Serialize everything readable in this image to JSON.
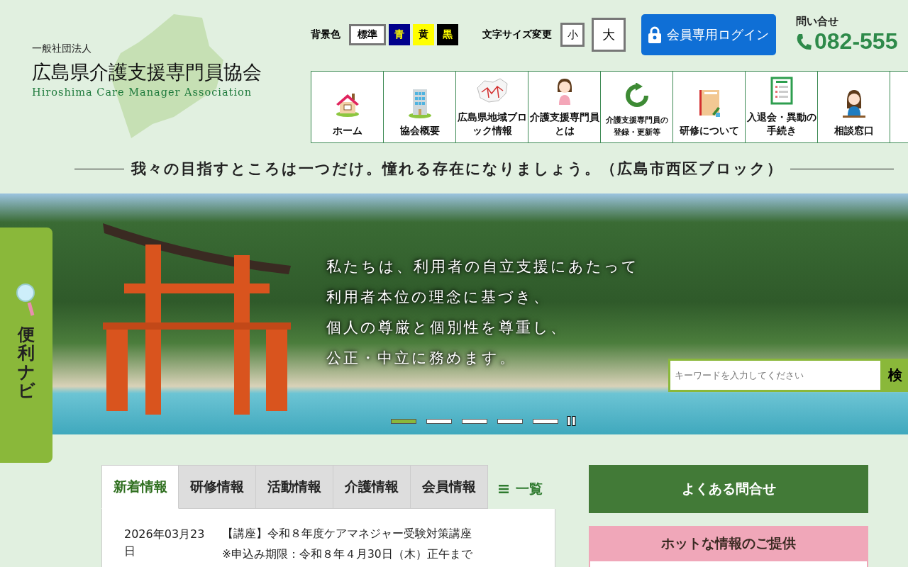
{
  "header": {
    "org_type": "一般社団法人",
    "org_name": "広島県介護支援専門員協会",
    "org_name_en": "Hiroshima Care Manager Association",
    "bg_color": {
      "label": "背景色",
      "options": [
        {
          "label": "標準",
          "kind": "standard",
          "selected": true
        },
        {
          "label": "青",
          "kind": "blue",
          "selected": false
        },
        {
          "label": "黄",
          "kind": "yellow",
          "selected": false
        },
        {
          "label": "黒",
          "kind": "black",
          "selected": false
        }
      ]
    },
    "font_size": {
      "label": "文字サイズ変更",
      "options": [
        {
          "label": "小",
          "kind": "small"
        },
        {
          "label": "大",
          "kind": "large"
        }
      ]
    },
    "login_button": "会員専用ログイン",
    "contact_label": "問い合せ",
    "phone": "082-555"
  },
  "nav": [
    {
      "kind": "house",
      "label": "ホーム"
    },
    {
      "kind": "building",
      "label": "協会概要"
    },
    {
      "kind": "map",
      "label": "広島県地域ブロック情報"
    },
    {
      "kind": "woman",
      "label": "介護支援専門員とは"
    },
    {
      "kind": "renew",
      "label": "介護支援専門員の登録・更新等"
    },
    {
      "kind": "notebook",
      "label": "研修について"
    },
    {
      "kind": "checklist",
      "label": "入退会・異動の手続き"
    },
    {
      "kind": "counselor",
      "label": "相談窓口"
    },
    {
      "kind": "cut"
    }
  ],
  "tagline": "我々の目指すところは一つだけ。憧れる存在になりましょう。（広島市西区ブロック）",
  "hero": {
    "lines": [
      "私たちは、利用者の自立支援にあたって",
      "利用者本位の理念に基づき、",
      "個人の尊厳と個別性を尊重し、",
      "公正・中立に務めます。"
    ],
    "slides": [
      {
        "selected": true
      },
      {
        "selected": false
      },
      {
        "selected": false
      },
      {
        "selected": false
      },
      {
        "selected": false
      }
    ],
    "search": {
      "placeholder": "キーワードを入力してください",
      "button": "検"
    }
  },
  "side_tab": {
    "label": "便利ナビ"
  },
  "news": {
    "tabs": [
      {
        "label": "新着情報",
        "selected": true
      },
      {
        "label": "研修情報",
        "selected": false
      },
      {
        "label": "活動情報",
        "selected": false
      },
      {
        "label": "介護情報",
        "selected": false
      },
      {
        "label": "会員情報",
        "selected": false
      }
    ],
    "list_link": "一覧",
    "items": [
      {
        "date": "2026年03月23日",
        "title": "【講座】令和８年度ケアマネジャー受験対策講座",
        "note": "※申込み期限：令和８年４月30日（木）正午まで"
      }
    ]
  },
  "faq_button": "よくある問合せ",
  "hot_info": {
    "title": "ホットな情報のご提供"
  }
}
